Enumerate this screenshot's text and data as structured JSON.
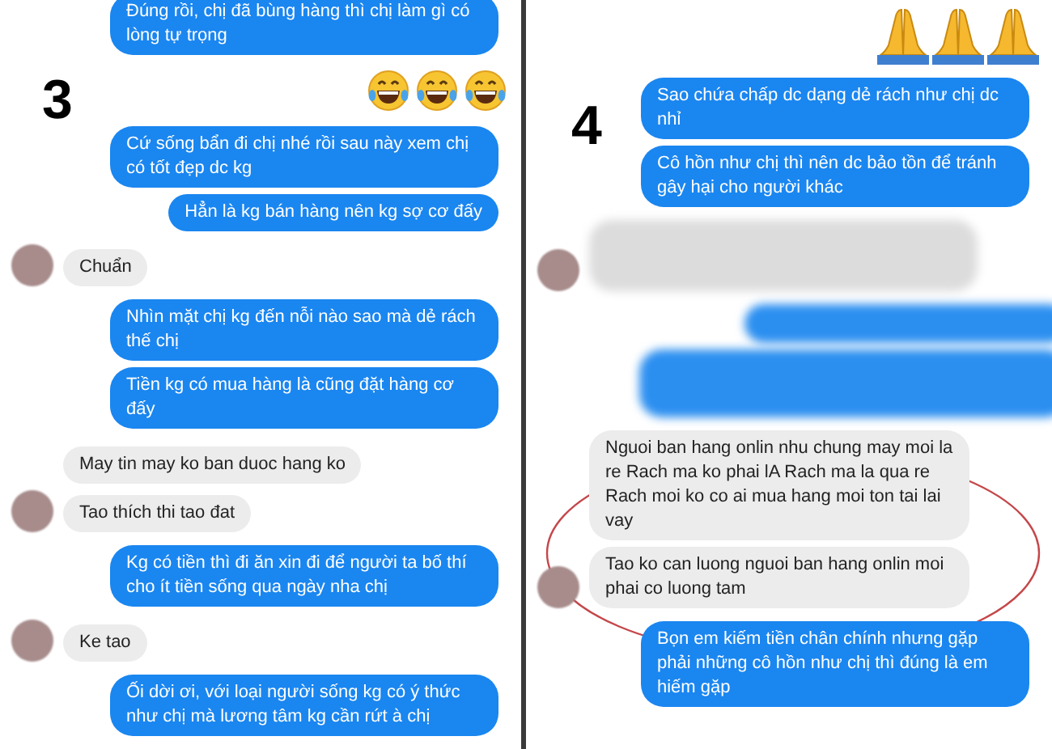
{
  "panels": [
    {
      "label": "3",
      "messages": [
        {
          "kind": "sent",
          "text": "Đúng rồi, chị đã bùng hàng thì chị làm gì có lòng tự trọng"
        },
        {
          "kind": "emoji",
          "icons": [
            {
              "kind": "laughing"
            },
            {
              "kind": "laughing"
            },
            {
              "kind": "laughing"
            }
          ]
        },
        {
          "kind": "sent",
          "text": "Cứ sống bẩn đi chị nhé rồi sau này xem chị có tốt đẹp dc kg"
        },
        {
          "kind": "sent",
          "text": "Hẳn là kg bán hàng nên kg sợ cơ đấy"
        },
        {
          "kind": "received",
          "text": "Chuẩn",
          "avatar": true
        },
        {
          "kind": "sent",
          "text": "Nhìn mặt chị kg đến nỗi nào sao mà dẻ rách thế chị"
        },
        {
          "kind": "sent",
          "text": "Tiền kg có mua hàng là cũng đặt hàng cơ đấy"
        },
        {
          "kind": "received",
          "text": "May tin may ko ban duoc hang ko",
          "avatar": false
        },
        {
          "kind": "received",
          "text": "Tao thích thi tao đat",
          "avatar": true
        },
        {
          "kind": "sent",
          "text": "Kg có tiền thì đi ăn xin đi để người ta bố thí cho ít tiền sống qua ngày nha chị"
        },
        {
          "kind": "received",
          "text": "Ke tao",
          "avatar": true
        },
        {
          "kind": "sent",
          "text": "Ối dời ơi, với loại người sống kg có ý thức như chị mà lương tâm kg cần rứt à chị"
        }
      ]
    },
    {
      "label": "4",
      "messages": [
        {
          "kind": "emoji",
          "icons": [
            {
              "kind": "praying"
            },
            {
              "kind": "praying"
            },
            {
              "kind": "praying"
            }
          ]
        },
        {
          "kind": "sent",
          "text": "Sao chứa chấp dc dạng dẻ rách như chị dc nhỉ"
        },
        {
          "kind": "sent",
          "text": "Cô hồn như chị thì nên dc bảo tồn để tránh gây hại cho người khác"
        },
        {
          "kind": "blurred-received",
          "avatar": true
        },
        {
          "kind": "blurred-sent"
        },
        {
          "kind": "blurred-sent-wide"
        },
        {
          "kind": "received",
          "text": "Nguoi ban hang onlin nhu chung may moi la re Rach ma ko phai lA Rach ma la qua re Rach moi ko co ai mua hang moi ton tai lai vay",
          "avatar": false
        },
        {
          "kind": "received",
          "text": "Tao ko can luong nguoi ban hang onlin moi phai co luong tam",
          "avatar": true
        },
        {
          "kind": "sent",
          "text": "Bọn em kiếm tiền chân chính nhưng gặp phải những cô hồn như chị thì đúng là em hiếm gặp"
        }
      ]
    }
  ]
}
